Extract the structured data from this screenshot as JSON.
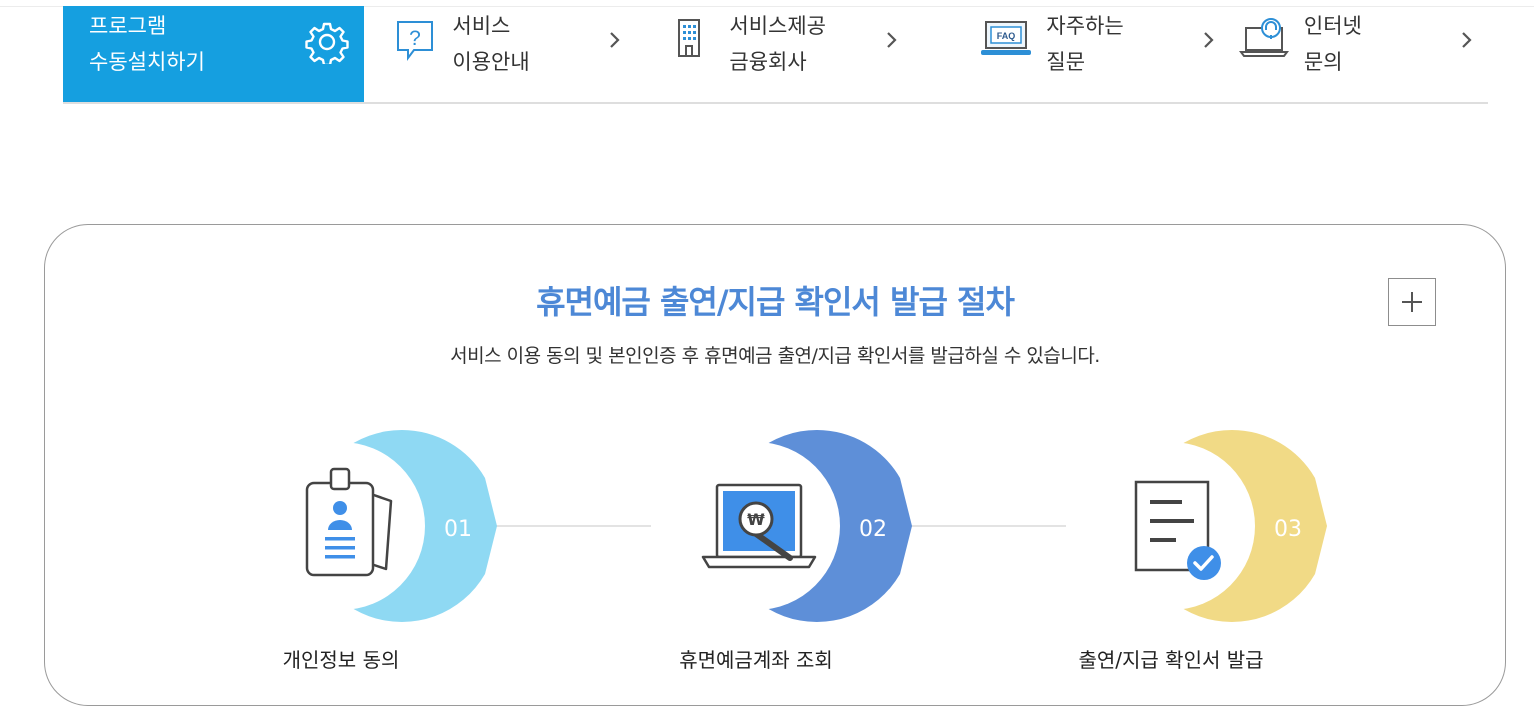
{
  "menu": {
    "primary": {
      "line1": "프로그램",
      "line2": "수동설치하기",
      "icon": "gear-icon"
    },
    "items": [
      {
        "line1": "서비스",
        "line2": "이용안내",
        "icon": "question-bubble-icon"
      },
      {
        "line1": "서비스제공",
        "line2": "금융회사",
        "icon": "building-icon"
      },
      {
        "line1": "자주하는",
        "line2": "질문",
        "icon": "faq-laptop-icon",
        "icon_text": "FAQ"
      },
      {
        "line1": "인터넷",
        "line2": "문의",
        "icon": "headset-laptop-icon"
      }
    ],
    "chevron": "›"
  },
  "section": {
    "title": "휴면예금 출연/지급 확인서 발급 절차",
    "description": "서비스 이용 동의 및 본인인증 후 휴면예금 출연/지급 확인서를 발급하실 수 있습니다.",
    "expand_icon": "plus-icon"
  },
  "steps": [
    {
      "number": "01",
      "label": "개인정보 동의",
      "color": "#8fd9f3",
      "icon": "id-card-icon"
    },
    {
      "number": "02",
      "label": "휴면예금계좌 조회",
      "color": "#5e8fd8",
      "icon": "laptop-search-won-icon",
      "icon_text": "₩"
    },
    {
      "number": "03",
      "label": "출연/지급 확인서 발급",
      "color": "#f1da86",
      "icon": "document-check-icon"
    }
  ],
  "colors": {
    "primary": "#159fe0",
    "title": "#4d88d6",
    "check": "#3f8fe8"
  }
}
